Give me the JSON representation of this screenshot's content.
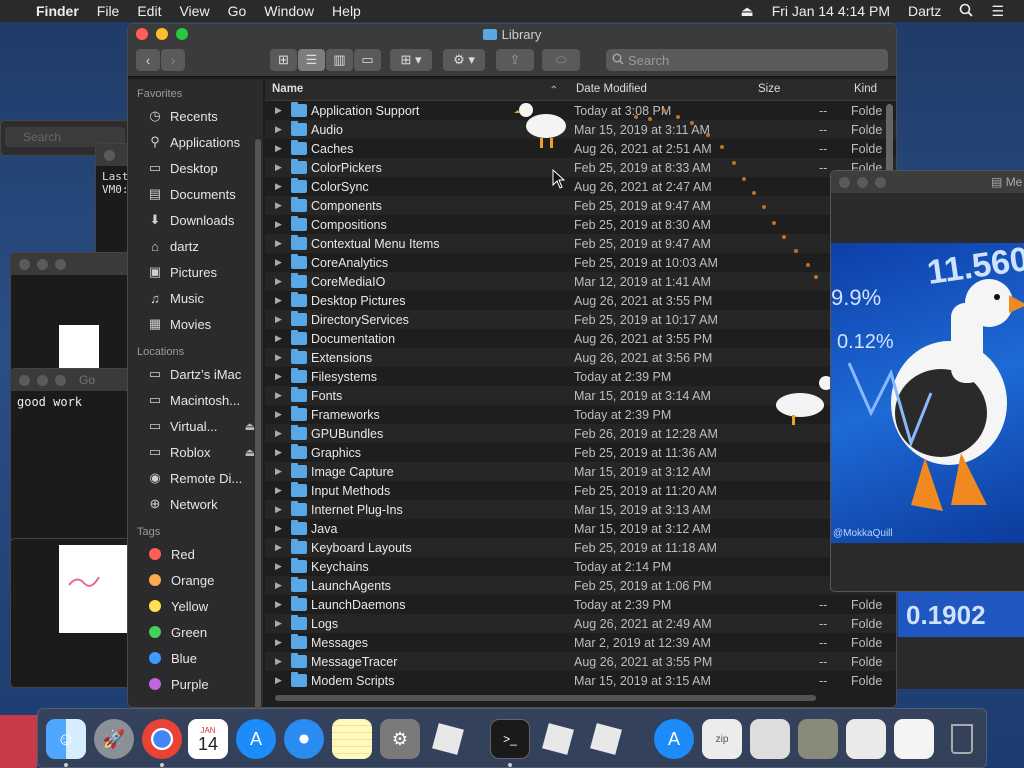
{
  "menubar": {
    "apple": "",
    "app_name": "Finder",
    "menus": [
      "File",
      "Edit",
      "View",
      "Go",
      "Window",
      "Help"
    ],
    "datetime": "Fri Jan 14  4:14 PM",
    "user": "Dartz"
  },
  "finder": {
    "title": "Library",
    "search_placeholder": "Search",
    "sidebar": {
      "favorites_header": "Favorites",
      "favorites": [
        {
          "label": "Recents",
          "icon": "clock-icon"
        },
        {
          "label": "Applications",
          "icon": "applications-icon"
        },
        {
          "label": "Desktop",
          "icon": "desktop-icon"
        },
        {
          "label": "Documents",
          "icon": "document-icon"
        },
        {
          "label": "Downloads",
          "icon": "download-icon"
        },
        {
          "label": "dartz",
          "icon": "home-icon"
        },
        {
          "label": "Pictures",
          "icon": "camera-icon"
        },
        {
          "label": "Music",
          "icon": "music-icon"
        },
        {
          "label": "Movies",
          "icon": "film-icon"
        }
      ],
      "locations_header": "Locations",
      "locations": [
        {
          "label": "Dartz’s iMac",
          "icon": "imac-icon"
        },
        {
          "label": "Macintosh...",
          "icon": "disk-icon"
        },
        {
          "label": "Virtual...",
          "icon": "disk-icon"
        },
        {
          "label": "Roblox",
          "icon": "disk-icon"
        },
        {
          "label": "Remote Di...",
          "icon": "disc-icon"
        },
        {
          "label": "Network",
          "icon": "globe-icon"
        }
      ],
      "tags_header": "Tags",
      "tags": [
        {
          "label": "Red",
          "color": "#ff5f57"
        },
        {
          "label": "Orange",
          "color": "#ffa94d"
        },
        {
          "label": "Yellow",
          "color": "#ffe14d"
        },
        {
          "label": "Green",
          "color": "#43d15a"
        },
        {
          "label": "Blue",
          "color": "#3d9bff"
        },
        {
          "label": "Purple",
          "color": "#c266e0"
        }
      ]
    },
    "columns": {
      "name": "Name",
      "date": "Date Modified",
      "size": "Size",
      "kind": "Kind"
    },
    "files": [
      {
        "name": "Application Support",
        "date": "Today at 3:08 PM",
        "size": "--",
        "kind": "Folde"
      },
      {
        "name": "Audio",
        "date": "Mar 15, 2019 at 3:11 AM",
        "size": "--",
        "kind": "Folde"
      },
      {
        "name": "Caches",
        "date": "Aug 26, 2021 at 2:51 AM",
        "size": "--",
        "kind": "Folde"
      },
      {
        "name": "ColorPickers",
        "date": "Feb 25, 2019 at 8:33 AM",
        "size": "--",
        "kind": "Folde"
      },
      {
        "name": "ColorSync",
        "date": "Aug 26, 2021 at 2:47 AM",
        "size": "",
        "kind": ""
      },
      {
        "name": "Components",
        "date": "Feb 25, 2019 at 9:47 AM",
        "size": "",
        "kind": ""
      },
      {
        "name": "Compositions",
        "date": "Feb 25, 2019 at 8:30 AM",
        "size": "",
        "kind": ""
      },
      {
        "name": "Contextual Menu Items",
        "date": "Feb 25, 2019 at 9:47 AM",
        "size": "",
        "kind": ""
      },
      {
        "name": "CoreAnalytics",
        "date": "Feb 25, 2019 at 10:03 AM",
        "size": "",
        "kind": ""
      },
      {
        "name": "CoreMediaIO",
        "date": "Mar 12, 2019 at 1:41 AM",
        "size": "",
        "kind": ""
      },
      {
        "name": "Desktop Pictures",
        "date": "Aug 26, 2021 at 3:55 PM",
        "size": "",
        "kind": ""
      },
      {
        "name": "DirectoryServices",
        "date": "Feb 25, 2019 at 10:17 AM",
        "size": "",
        "kind": ""
      },
      {
        "name": "Documentation",
        "date": "Aug 26, 2021 at 3:55 PM",
        "size": "",
        "kind": ""
      },
      {
        "name": "Extensions",
        "date": "Aug 26, 2021 at 3:56 PM",
        "size": "",
        "kind": ""
      },
      {
        "name": "Filesystems",
        "date": "Today at 2:39 PM",
        "size": "",
        "kind": ""
      },
      {
        "name": "Fonts",
        "date": "Mar 15, 2019 at 3:14 AM",
        "size": "",
        "kind": ""
      },
      {
        "name": "Frameworks",
        "date": "Today at 2:39 PM",
        "size": "",
        "kind": ""
      },
      {
        "name": "GPUBundles",
        "date": "Feb 26, 2019 at 12:28 AM",
        "size": "",
        "kind": ""
      },
      {
        "name": "Graphics",
        "date": "Feb 25, 2019 at 11:36 AM",
        "size": "",
        "kind": ""
      },
      {
        "name": "Image Capture",
        "date": "Mar 15, 2019 at 3:12 AM",
        "size": "",
        "kind": ""
      },
      {
        "name": "Input Methods",
        "date": "Feb 25, 2019 at 11:20 AM",
        "size": "",
        "kind": ""
      },
      {
        "name": "Internet Plug-Ins",
        "date": "Mar 15, 2019 at 3:13 AM",
        "size": "",
        "kind": ""
      },
      {
        "name": "Java",
        "date": "Mar 15, 2019 at 3:12 AM",
        "size": "",
        "kind": ""
      },
      {
        "name": "Keyboard Layouts",
        "date": "Feb 25, 2019 at 11:18 AM",
        "size": "",
        "kind": ""
      },
      {
        "name": "Keychains",
        "date": "Today at 2:14 PM",
        "size": "",
        "kind": ""
      },
      {
        "name": "LaunchAgents",
        "date": "Feb 25, 2019 at 1:06 PM",
        "size": "",
        "kind": ""
      },
      {
        "name": "LaunchDaemons",
        "date": "Today at 2:39 PM",
        "size": "--",
        "kind": "Folde"
      },
      {
        "name": "Logs",
        "date": "Aug 26, 2021 at 2:49 AM",
        "size": "--",
        "kind": "Folde"
      },
      {
        "name": "Messages",
        "date": "Mar 2, 2019 at 12:39 AM",
        "size": "--",
        "kind": "Folde"
      },
      {
        "name": "MessageTracer",
        "date": "Aug 26, 2021 at 3:55 PM",
        "size": "--",
        "kind": "Folde"
      },
      {
        "name": "Modem Scripts",
        "date": "Mar 15, 2019 at 3:15 AM",
        "size": "--",
        "kind": "Folde"
      }
    ]
  },
  "background_windows": {
    "search_placeholder": "Search",
    "terminal_line1": "Last",
    "terminal_line2": "VM0:",
    "note_text": "good work",
    "note_title": "Go"
  },
  "image_window": {
    "title": "Me",
    "art_numbers": [
      "11.560",
      "0.1902",
      "0.12%",
      "9.9%"
    ],
    "credit": "@MokkaQuill"
  },
  "dock": {
    "calendar_month": "JAN",
    "calendar_day": "14",
    "apps": [
      "finder-icon",
      "launchpad-icon",
      "chrome-icon",
      "calendar-icon",
      "app-store-icon",
      "safari-icon",
      "notes-icon",
      "system-preferences-icon",
      "roblox-icon",
      "terminal-icon",
      "roblox-studio-icon",
      "roblox-player-icon",
      "app-store-icon",
      "archive-icon",
      "screenshot-icon",
      "image-icon",
      "image-icon",
      "screenshot-icon",
      "trash-icon"
    ]
  }
}
